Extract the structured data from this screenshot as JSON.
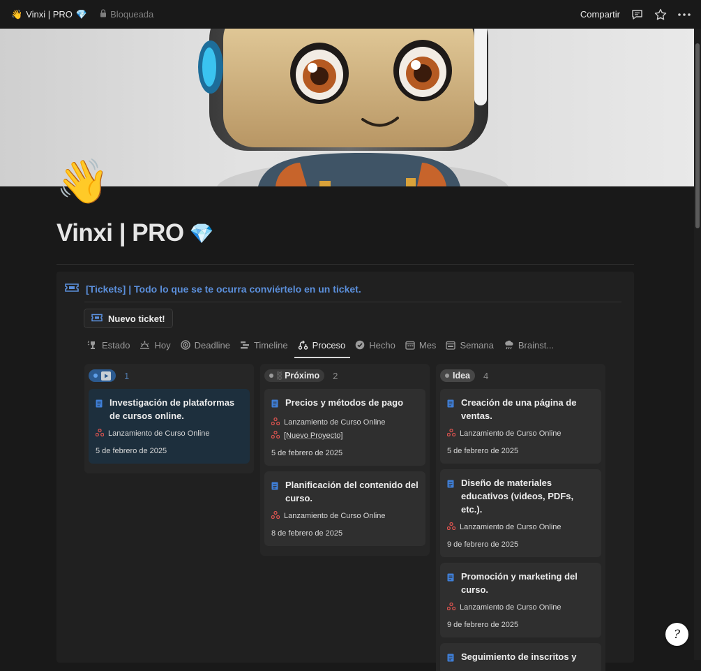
{
  "topbar": {
    "page_emoji": "👋",
    "page_title": "Vinxi | PRO",
    "title_gem": "💎",
    "locked_label": "Bloqueada",
    "share_label": "Compartir"
  },
  "page": {
    "emoji": "👋",
    "title": "Vinxi | PRO",
    "title_gem": "💎"
  },
  "database": {
    "header": "[Tickets] | Todo lo que se te ocurra conviértelo en un ticket.",
    "new_button": "Nuevo ticket!",
    "tabs": [
      {
        "label": "Estado",
        "icon": "sparkle-trophy-icon"
      },
      {
        "label": "Hoy",
        "icon": "sunrise-icon"
      },
      {
        "label": "Deadline",
        "icon": "target-icon"
      },
      {
        "label": "Timeline",
        "icon": "timeline-icon"
      },
      {
        "label": "Proceso",
        "icon": "flow-icon",
        "active": true
      },
      {
        "label": "Hecho",
        "icon": "check-circle-icon"
      },
      {
        "label": "Mes",
        "icon": "calendar-icon"
      },
      {
        "label": "Semana",
        "icon": "calendar-week-icon"
      },
      {
        "label": "Brainst...",
        "icon": "brain-storm-icon"
      }
    ],
    "columns": [
      {
        "status": "▶",
        "count": "1",
        "cards": [
          {
            "title": "Investigación de plataformas de cursos online.",
            "relations": [
              "Lanzamiento de Curso Online"
            ],
            "date": "5 de febrero de 2025"
          }
        ]
      },
      {
        "status": "Próximo",
        "count": "2",
        "cards": [
          {
            "title": "Precios y métodos de pago",
            "relations": [
              "Lanzamiento de Curso Online",
              "[Nuevo Proyecto]"
            ],
            "date": "5 de febrero de 2025"
          },
          {
            "title": "Planificación del contenido del curso.",
            "relations": [
              "Lanzamiento de Curso Online"
            ],
            "date": "8 de febrero de 2025"
          }
        ]
      },
      {
        "status": "Idea",
        "count": "4",
        "cards": [
          {
            "title": "Creación de una página de ventas.",
            "relations": [
              "Lanzamiento de Curso Online"
            ],
            "date": "5 de febrero de 2025"
          },
          {
            "title": "Diseño de materiales educativos (videos, PDFs, etc.).",
            "relations": [
              "Lanzamiento de Curso Online"
            ],
            "date": "9 de febrero de 2025"
          },
          {
            "title": "Promoción y marketing del curso.",
            "relations": [
              "Lanzamiento de Curso Online"
            ],
            "date": "9 de febrero de 2025"
          },
          {
            "title": "Seguimiento de inscritos y"
          }
        ]
      }
    ]
  },
  "help": {
    "glyph": "?"
  },
  "colors": {
    "accent": "#5b8fdb",
    "relation": "#d9534f",
    "doc_icon": "#3f7fd8"
  }
}
